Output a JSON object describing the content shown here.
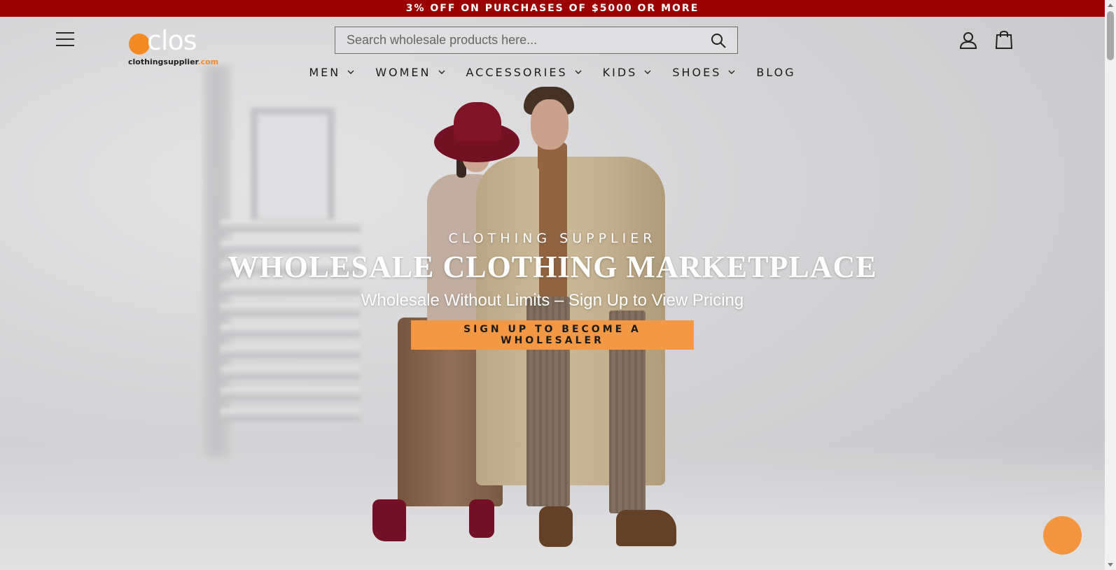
{
  "announcement": {
    "text": "3% OFF ON PURCHASES OF $5000 OR MORE"
  },
  "header": {
    "logo": {
      "wordmark": "clos",
      "domain_main": "clothingsupplier",
      "domain_tld": ".com"
    },
    "search": {
      "placeholder": "Search wholesale products here..."
    },
    "icons": {
      "menu": "hamburger-menu-icon",
      "search": "search-icon",
      "account": "user-icon",
      "cart": "shopping-bag-icon"
    }
  },
  "nav": {
    "items": [
      {
        "label": "MEN",
        "has_dropdown": true
      },
      {
        "label": "WOMEN",
        "has_dropdown": true
      },
      {
        "label": "ACCESSORIES",
        "has_dropdown": true
      },
      {
        "label": "KIDS",
        "has_dropdown": true
      },
      {
        "label": "SHOES",
        "has_dropdown": true
      },
      {
        "label": "BLOG",
        "has_dropdown": false
      }
    ]
  },
  "hero": {
    "eyebrow": "CLOTHING SUPPLIER",
    "headline": "WHOLESALE CLOTHING MARKETPLACE",
    "subhead": "Wholesale Without Limits – Sign Up to View Pricing",
    "cta_label": "SIGN UP TO BECOME A WHOLESALER"
  },
  "colors": {
    "announcement_bg": "#9b0000",
    "accent_orange": "#f39945",
    "logo_orange": "#f38a24"
  }
}
